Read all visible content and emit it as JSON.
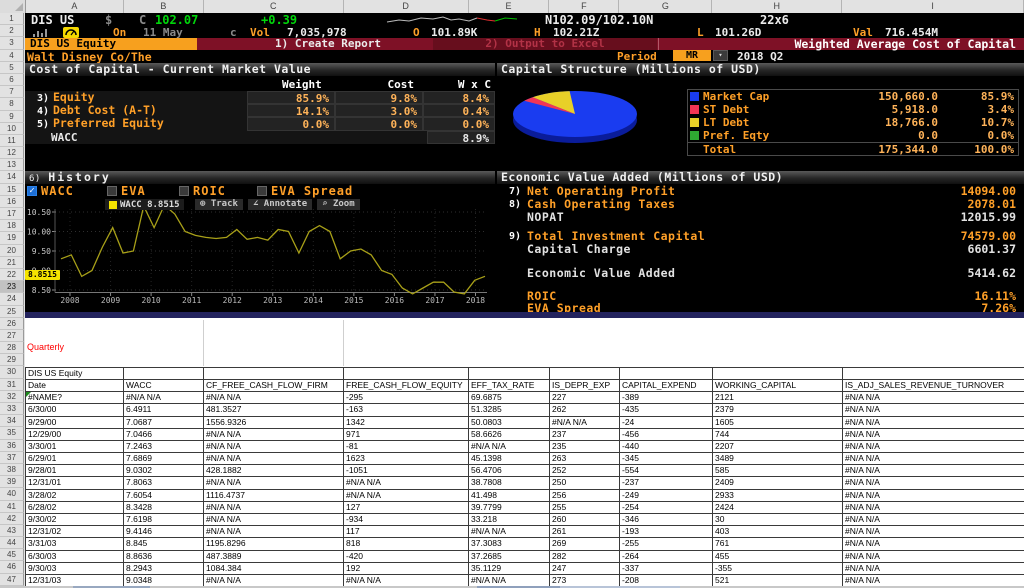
{
  "terminal": {
    "quote_line": {
      "ticker": "DIS US",
      "currency": "$",
      "c_label": "C",
      "last": "102.07",
      "change": "+0.39",
      "bid_ask": "N102.09/102.10N",
      "lot": "22x6"
    },
    "trade_line": {
      "on_label": "On",
      "date": "11 May",
      "c_flag": "c",
      "vol_label": "Vol",
      "volume": "7,035,978",
      "o_label": "O",
      "open": "101.89K",
      "h_label": "H",
      "high": "102.21Z",
      "l_label": "L",
      "low": "101.26D",
      "val_label": "Val",
      "value": "716.454M"
    },
    "toolbar": {
      "security": "DIS US Equity",
      "create_report": "1) Create Report",
      "output_excel": "2) Output to Excel",
      "title": "Weighted Average Cost of Capital"
    },
    "subheader": {
      "company": "Walt Disney Co/The",
      "period_label": "Period",
      "period_value": "MR",
      "period_detail": "2018 Q2"
    },
    "cost_of_capital": {
      "title": "Cost of Capital - Current Market Value",
      "headers": [
        "Weight",
        "Cost",
        "W x C"
      ],
      "rows": [
        {
          "num": "3)",
          "label": "Equity",
          "weight": "85.9%",
          "cost": "9.8%",
          "wxc": "8.4%"
        },
        {
          "num": "4)",
          "label": "Debt Cost (A-T)",
          "weight": "14.1%",
          "cost": "3.0%",
          "wxc": "0.4%"
        },
        {
          "num": "5)",
          "label": "Preferred Equity",
          "weight": "0.0%",
          "cost": "0.0%",
          "wxc": "0.0%"
        }
      ],
      "wacc_label": "WACC",
      "wacc_value": "8.9%"
    },
    "capital_structure": {
      "title": "Capital Structure (Millions of USD)",
      "legend": [
        {
          "label": "Market Cap",
          "value": "150,660.0",
          "pct": "85.9%",
          "color": "#1a3cf0"
        },
        {
          "label": "ST Debt",
          "value": "5,918.0",
          "pct": "3.4%",
          "color": "#f23554"
        },
        {
          "label": "LT Debt",
          "value": "18,766.0",
          "pct": "10.7%",
          "color": "#e8d028"
        },
        {
          "label": "Pref. Eqty",
          "value": "0.0",
          "pct": "0.0%",
          "color": "#2fa832"
        },
        {
          "label": "Total",
          "value": "175,344.0",
          "pct": "100.0%",
          "color": null
        }
      ]
    },
    "history": {
      "num": "6)",
      "title": "History",
      "toggles": [
        {
          "label": "WACC",
          "checked": true
        },
        {
          "label": "EVA",
          "checked": false
        },
        {
          "label": "ROIC",
          "checked": false
        },
        {
          "label": "EVA Spread",
          "checked": false
        }
      ],
      "legend": "WACC 8.8515",
      "buttons": [
        {
          "icon": "⊕",
          "label": "Track"
        },
        {
          "icon": "∠",
          "label": "Annotate"
        },
        {
          "icon": "⌕",
          "label": "Zoom"
        }
      ],
      "last_badge": "8.8515"
    },
    "eva": {
      "title": "Economic Value Added (Millions of USD)",
      "rows": [
        {
          "num": "7)",
          "label": "Net Operating Profit",
          "value": "14094.00",
          "tone": "orange"
        },
        {
          "num": "8)",
          "label": "Cash Operating Taxes",
          "value": "2078.01",
          "tone": "orange"
        },
        {
          "num": "",
          "label": "NOPAT",
          "value": "12015.99",
          "tone": "white"
        },
        {
          "num": "9)",
          "label": "Total Investment Capital",
          "value": "74579.00",
          "tone": "orange"
        },
        {
          "num": "",
          "label": "Capital Charge",
          "value": "6601.37",
          "tone": "white"
        },
        {
          "num": "",
          "label": "Economic Value Added",
          "value": "5414.62",
          "tone": "white"
        },
        {
          "num": "",
          "label": "ROIC",
          "value": "16.11%",
          "tone": "orange"
        },
        {
          "num": "",
          "label": "EVA Spread",
          "value": "7.26%",
          "tone": "orange"
        }
      ]
    }
  },
  "chart_data": [
    {
      "type": "line",
      "title": "History - WACC",
      "legend": "WACC 8.8515",
      "x_start": "2008Q1",
      "x_end": "2018Q2",
      "x_ticks": [
        "2008",
        "2009",
        "2010",
        "2011",
        "2012",
        "2013",
        "2014",
        "2015",
        "2016",
        "2017",
        "2018"
      ],
      "y_ticks": [
        10.5,
        10.0,
        9.5,
        9.0,
        8.5
      ],
      "ylim": [
        8.3,
        10.75
      ],
      "grid": "dotted",
      "last_value": 8.8515,
      "series": [
        {
          "name": "WACC",
          "values": [
            9.3,
            9.4,
            8.85,
            9.0,
            9.6,
            10.1,
            9.45,
            9.5,
            10.65,
            10.1,
            10.68,
            10.45,
            10.0,
            9.9,
            9.85,
            9.82,
            9.85,
            10.05,
            9.8,
            9.85,
            9.78,
            10.05,
            10.0,
            9.45,
            10.0,
            10.15,
            10.0,
            9.3,
            9.5,
            9.55,
            9.4,
            9.0,
            8.9,
            8.55,
            8.4,
            8.55,
            8.7,
            8.7,
            8.45,
            8.4,
            8.75,
            8.8515
          ]
        }
      ]
    },
    {
      "type": "pie",
      "title": "Capital Structure (Millions of USD)",
      "labels": [
        "Market Cap",
        "ST Debt",
        "LT Debt",
        "Pref. Eqty"
      ],
      "values": [
        150660.0,
        5918.0,
        18766.0,
        0.0
      ],
      "pct": [
        85.9,
        3.4,
        10.7,
        0.0
      ],
      "total": 175344.0
    }
  ],
  "spreadsheet": {
    "columns": [
      "A",
      "B",
      "C",
      "D",
      "E",
      "F",
      "G",
      "H",
      "I"
    ],
    "visible_rows": 47,
    "selected_row": 23,
    "quarterly_label": "Quarterly",
    "table_title": "DIS US Equity",
    "headers": [
      "Date",
      "WACC",
      "CF_FREE_CASH_FLOW_FIRM",
      "FREE_CASH_FLOW_EQUITY",
      "EFF_TAX_RATE",
      "IS_DEPR_EXP",
      "CAPITAL_EXPEND",
      "WORKING_CAPITAL",
      "IS_ADJ_SALES_REVENUE_TURNOVER"
    ],
    "rows": [
      [
        "#NAME?",
        "#N/A N/A",
        "#N/A N/A",
        "-295",
        "69.6875",
        "227",
        "-389",
        "2121",
        "#N/A N/A"
      ],
      [
        "6/30/00",
        "6.4911",
        "481.3527",
        "-163",
        "51.3285",
        "262",
        "-435",
        "2379",
        "#N/A N/A"
      ],
      [
        "9/29/00",
        "7.0687",
        "1556.9326",
        "1342",
        "50.0803",
        "#N/A N/A",
        "-24",
        "1605",
        "#N/A N/A"
      ],
      [
        "12/29/00",
        "7.0466",
        "#N/A N/A",
        "971",
        "58.6626",
        "237",
        "-456",
        "744",
        "#N/A N/A"
      ],
      [
        "3/30/01",
        "7.2463",
        "#N/A N/A",
        "-81",
        "#N/A N/A",
        "235",
        "-440",
        "2207",
        "#N/A N/A"
      ],
      [
        "6/29/01",
        "7.6869",
        "#N/A N/A",
        "1623",
        "45.1398",
        "263",
        "-345",
        "3489",
        "#N/A N/A"
      ],
      [
        "9/28/01",
        "9.0302",
        "428.1882",
        "-1051",
        "56.4706",
        "252",
        "-554",
        "585",
        "#N/A N/A"
      ],
      [
        "12/31/01",
        "7.8063",
        "#N/A N/A",
        "#N/A N/A",
        "38.7808",
        "250",
        "-237",
        "2409",
        "#N/A N/A"
      ],
      [
        "3/28/02",
        "7.6054",
        "1116.4737",
        "#N/A N/A",
        "41.498",
        "256",
        "-249",
        "2933",
        "#N/A N/A"
      ],
      [
        "6/28/02",
        "8.3428",
        "#N/A N/A",
        "127",
        "39.7799",
        "255",
        "-254",
        "2424",
        "#N/A N/A"
      ],
      [
        "9/30/02",
        "7.6198",
        "#N/A N/A",
        "-934",
        "33.218",
        "260",
        "-346",
        "30",
        "#N/A N/A"
      ],
      [
        "12/31/02",
        "9.4146",
        "#N/A N/A",
        "117",
        "#N/A N/A",
        "261",
        "-193",
        "403",
        "#N/A N/A"
      ],
      [
        "3/31/03",
        "8.845",
        "1195.8296",
        "818",
        "37.3083",
        "269",
        "-255",
        "761",
        "#N/A N/A"
      ],
      [
        "6/30/03",
        "8.8636",
        "487.3889",
        "-420",
        "37.2685",
        "282",
        "-264",
        "455",
        "#N/A N/A"
      ],
      [
        "9/30/03",
        "8.2943",
        "1084.384",
        "192",
        "35.1129",
        "247",
        "-337",
        "-355",
        "#N/A N/A"
      ],
      [
        "12/31/03",
        "9.0348",
        "#N/A N/A",
        "#N/A N/A",
        "#N/A N/A",
        "273",
        "-208",
        "521",
        "#N/A N/A"
      ]
    ]
  }
}
